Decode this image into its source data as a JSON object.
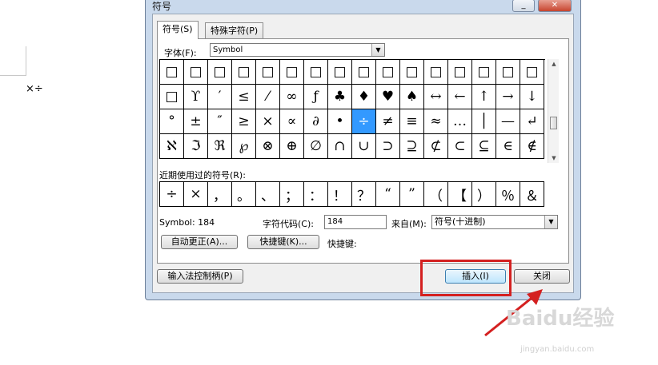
{
  "document": {
    "text": "×÷"
  },
  "dialog": {
    "title": "符号",
    "minimize_label": "_",
    "close_label": "✕",
    "tabs": [
      {
        "label": "符号(S)"
      },
      {
        "label": "特殊字符(P)"
      }
    ],
    "font": {
      "label": "字体(F):",
      "value": "Symbol"
    },
    "symbol_grid": [
      [
        "□",
        "□",
        "□",
        "□",
        "□",
        "□",
        "□",
        "□",
        "□",
        "□",
        "□",
        "□",
        "□",
        "□",
        "□",
        "□"
      ],
      [
        "□",
        "ϒ",
        "′",
        "≤",
        "⁄",
        "∞",
        "ƒ",
        "♣",
        "♦",
        "♥",
        "♠",
        "↔",
        "←",
        "↑",
        "→",
        "↓"
      ],
      [
        "°",
        "±",
        "″",
        "≥",
        "×",
        "∝",
        "∂",
        "•",
        "÷",
        "≠",
        "≡",
        "≈",
        "…",
        "│",
        "—",
        "↵"
      ],
      [
        "ℵ",
        "ℑ",
        "ℜ",
        "℘",
        "⊗",
        "⊕",
        "∅",
        "∩",
        "∪",
        "⊃",
        "⊇",
        "⊄",
        "⊂",
        "⊆",
        "∈",
        "∉"
      ]
    ],
    "selected_symbol": "÷",
    "recent_label": "近期使用过的符号(R):",
    "recent_symbols": [
      "÷",
      "×",
      "，",
      "。",
      "、",
      "；",
      "：",
      "！",
      "？",
      "“",
      "”",
      "（",
      "【",
      "）",
      "％",
      "＆"
    ],
    "status": {
      "symbol_info": "Symbol: 184",
      "char_code_label": "字符代码(C):",
      "char_code_value": "184",
      "from_label": "来自(M):",
      "from_value": "符号(十进制)"
    },
    "buttons": {
      "autocorrect": "自动更正(A)...",
      "shortcut_key": "快捷键(K)...",
      "shortcut_label": "快捷键:",
      "ime_handle": "输入法控制柄(P)",
      "insert": "插入(I)",
      "close": "关闭"
    }
  },
  "watermark": {
    "brand": "Baidu经验",
    "url": "jingyan.baidu.com"
  },
  "colors": {
    "selection": "#3399ff",
    "highlight_box": "#d42020",
    "dialog_frame": "#c9d9ec"
  }
}
